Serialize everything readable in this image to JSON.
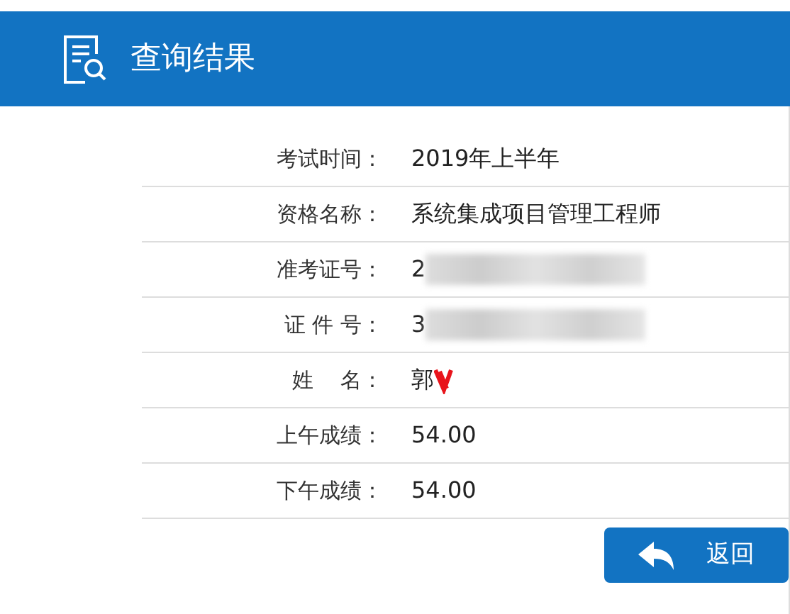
{
  "header": {
    "title": "查询结果"
  },
  "rows": [
    {
      "label": "考试时间：",
      "value": "2019年上半年",
      "redacted": false,
      "scribbled": false
    },
    {
      "label": "资格名称：",
      "value": "系统集成项目管理工程师",
      "redacted": false,
      "scribbled": false
    },
    {
      "label": "准考证号：",
      "value": "2",
      "redacted": true,
      "scribbled": false
    },
    {
      "label": "证 件 号：",
      "value": "3",
      "redacted": true,
      "scribbled": false
    },
    {
      "label": "姓    名：",
      "value": "郭",
      "redacted": false,
      "scribbled": true
    },
    {
      "label": "上午成绩：",
      "value": "54.00",
      "redacted": false,
      "scribbled": false
    },
    {
      "label": "下午成绩：",
      "value": "54.00",
      "redacted": false,
      "scribbled": false
    }
  ],
  "back_button": {
    "label": "返回"
  }
}
